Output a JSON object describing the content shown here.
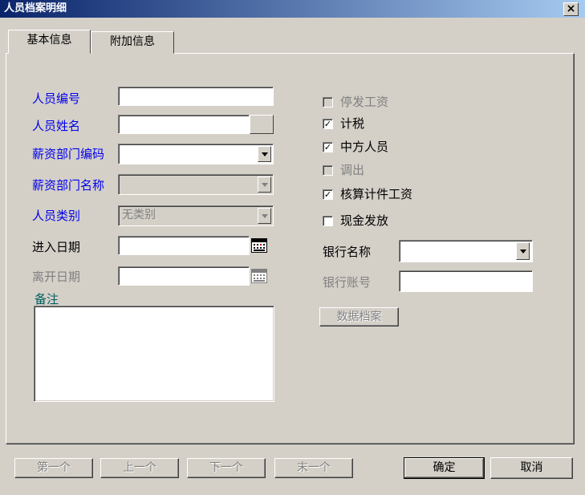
{
  "window": {
    "title": "人员档案明细",
    "close_label": "×"
  },
  "tabs": [
    {
      "label": "基本信息"
    },
    {
      "label": "附加信息"
    }
  ],
  "form": {
    "emp_no": {
      "label": "人员编号",
      "value": ""
    },
    "emp_name": {
      "label": "人员姓名",
      "value": ""
    },
    "dept_code": {
      "label": "薪资部门编码",
      "value": ""
    },
    "dept_name": {
      "label": "薪资部门名称",
      "value": ""
    },
    "emp_type": {
      "label": "人员类别",
      "value": "无类别"
    },
    "entry_date": {
      "label": "进入日期",
      "value": ""
    },
    "leave_date": {
      "label": "离开日期",
      "value": ""
    },
    "remark": {
      "label": "备注",
      "value": ""
    }
  },
  "options": [
    {
      "label": "停发工资",
      "checked": false,
      "enabled": false
    },
    {
      "label": "计税",
      "checked": true,
      "enabled": true
    },
    {
      "label": "中方人员",
      "checked": true,
      "enabled": true
    },
    {
      "label": "调出",
      "checked": false,
      "enabled": false
    },
    {
      "label": "核算计件工资",
      "checked": true,
      "enabled": true
    },
    {
      "label": "现金发放",
      "checked": false,
      "enabled": true
    }
  ],
  "bank": {
    "name_label": "银行名称",
    "name_value": "",
    "account_label": "银行账号",
    "account_value": ""
  },
  "data_archive_button": "数据档案",
  "nav": {
    "first": "第一个",
    "prev": "上一个",
    "next": "下一个",
    "last": "末一个"
  },
  "actions": {
    "ok": "确定",
    "cancel": "取消"
  },
  "icons": {
    "calendar": "calendar-icon",
    "arrow": "chevron-down-icon",
    "close": "close-icon"
  },
  "colors": {
    "title_bar_start": "#0a246a",
    "title_bar_end": "#a6caf0",
    "label_blue": "#0000ee",
    "disabled_gray": "#808080",
    "face": "#d4d0c8"
  }
}
